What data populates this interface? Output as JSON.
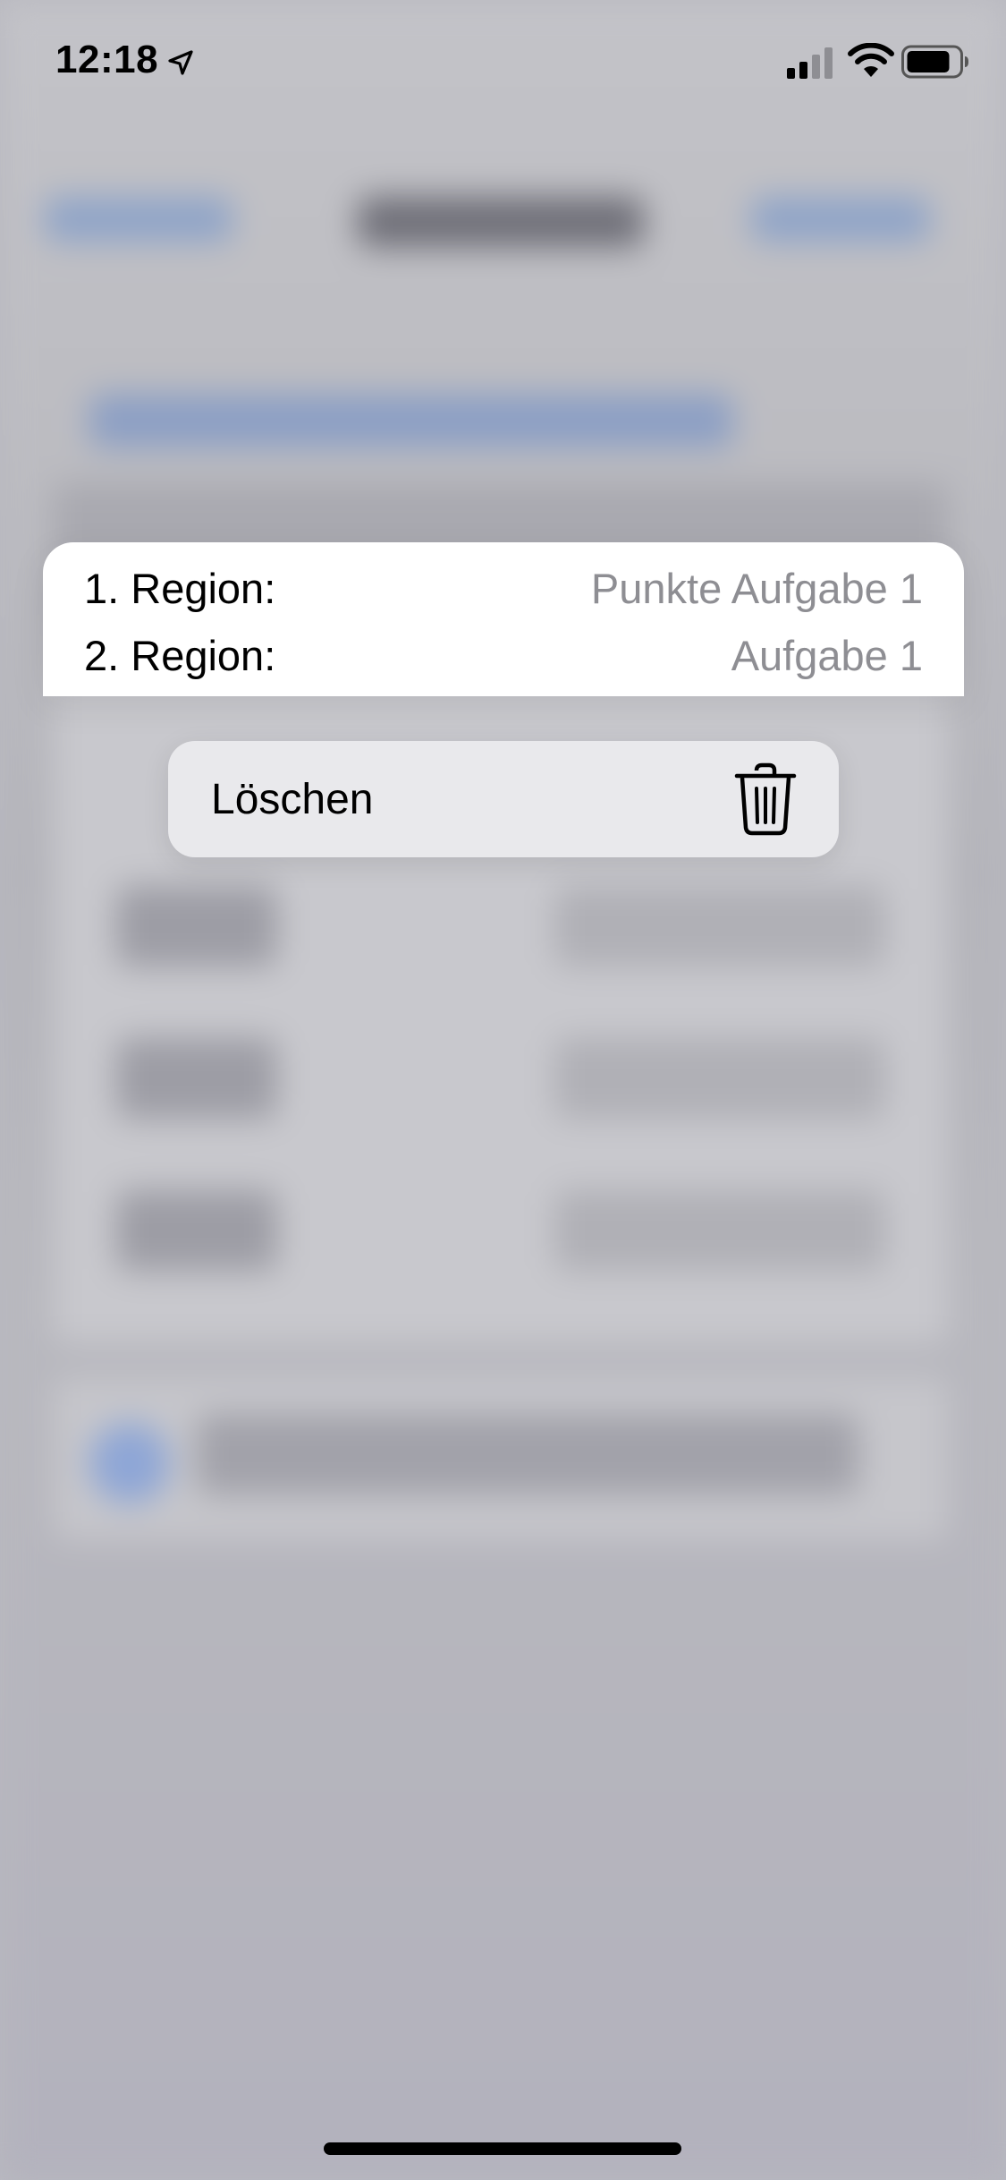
{
  "status_bar": {
    "time": "12:18",
    "icons": [
      "location-arrow-icon",
      "cellular-signal-icon",
      "wifi-icon",
      "battery-icon"
    ]
  },
  "preview": {
    "rows": [
      {
        "label": "1. Region:",
        "value": "Punkte Aufgabe 1"
      },
      {
        "label": "2. Region:",
        "value": "Aufgabe 1"
      }
    ]
  },
  "context_menu": {
    "items": [
      {
        "label": "Löschen",
        "icon": "trash-icon"
      }
    ]
  },
  "colors": {
    "label_text": "#000000",
    "value_text": "#8e8e93",
    "menu_background": "#e9e9ec",
    "card_background": "#ffffff"
  }
}
